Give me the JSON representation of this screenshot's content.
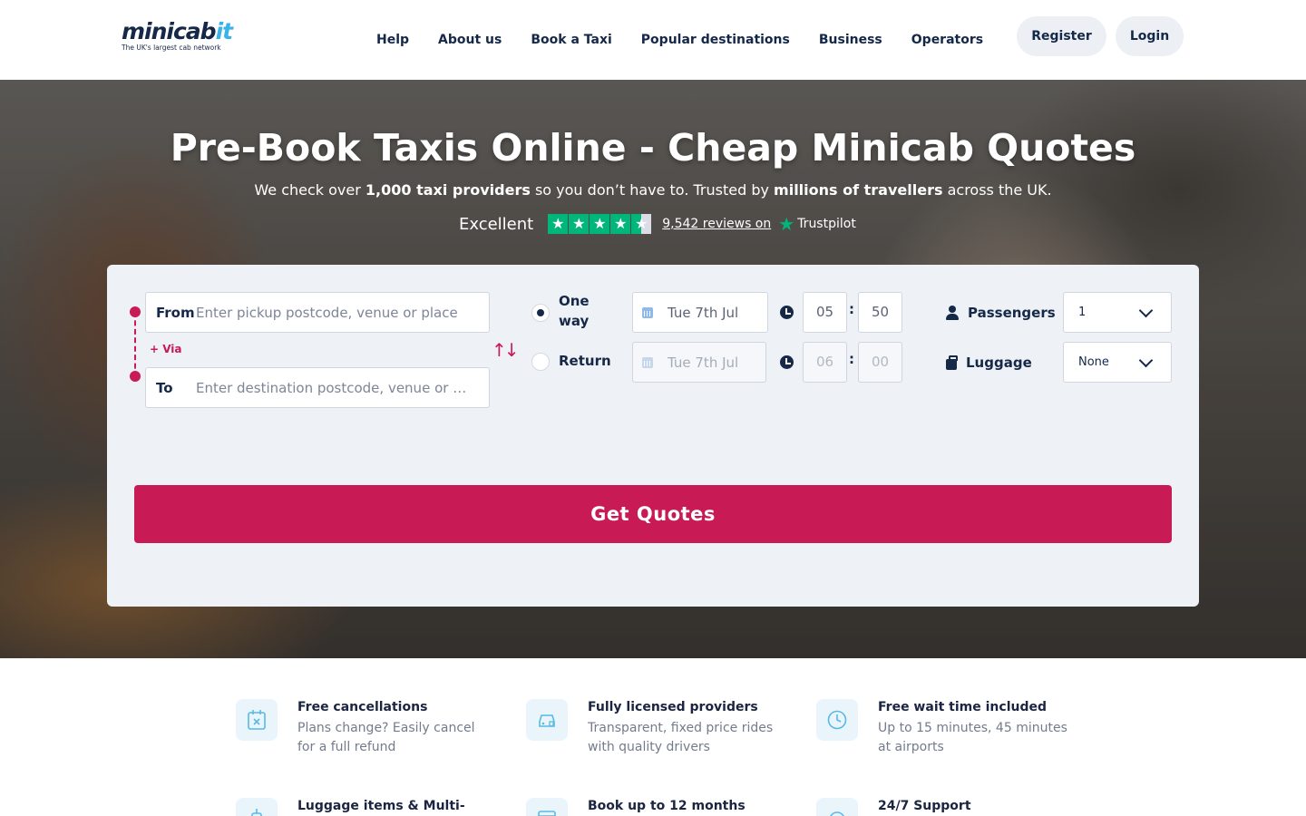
{
  "header": {
    "logo_text_main": "minicab",
    "logo_text_accent": "it",
    "logo_tagline": "The UK's largest cab network",
    "nav": [
      "Help",
      "About us",
      "Book a Taxi",
      "Popular destinations",
      "Business",
      "Operators"
    ],
    "register": "Register",
    "login": "Login"
  },
  "hero": {
    "title": "Pre-Book Taxis Online - Cheap Minicab Quotes",
    "sub_1": "We check over ",
    "sub_bold_1": "1,000 taxi providers",
    "sub_2": " so you don’t have to. Trusted by ",
    "sub_bold_2": "millions of travellers",
    "sub_3": " across the UK.",
    "rating_word": "Excellent",
    "rating_stars": 4.5,
    "reviews_text": "9,542 reviews on",
    "trustpilot": "Trustpilot"
  },
  "booking": {
    "from_label": "From",
    "from_placeholder": "Enter pickup postcode, venue or place",
    "via_label": "+ Via",
    "to_label": "To",
    "to_placeholder": "Enter destination postcode, venue or place",
    "swap_icon": "swap-arrows-icon",
    "one_way_label": "One way",
    "return_label": "Return",
    "selected_trip": "One way",
    "outbound_date": "Tue 7th Jul",
    "outbound_hour": "05",
    "outbound_minute": "50",
    "return_date": "Tue 7th Jul",
    "return_hour": "06",
    "return_minute": "00",
    "passengers_label": "Passengers",
    "passengers_value": "1",
    "luggage_label": "Luggage",
    "luggage_value": "None",
    "cta": "Get Quotes",
    "accent_color": "#c81a55"
  },
  "features": [
    {
      "title": "Free cancellations",
      "desc": "Plans change? Easily cancel for a full refund",
      "icon": "calendar-x-icon"
    },
    {
      "title": "Fully licensed providers",
      "desc": "Transparent, fixed price rides with quality drivers",
      "icon": "car-shield-icon"
    },
    {
      "title": "Free wait time included",
      "desc": "Up to 15 minutes, 45 minutes at airports",
      "icon": "clock-icon"
    },
    {
      "title": "Luggage items & Multi-",
      "desc": "",
      "icon": "luggage-icon"
    },
    {
      "title": "Book up to 12 months",
      "desc": "",
      "icon": "calendar-icon"
    },
    {
      "title": "24/7 Support",
      "desc": "",
      "icon": "support-icon"
    }
  ]
}
